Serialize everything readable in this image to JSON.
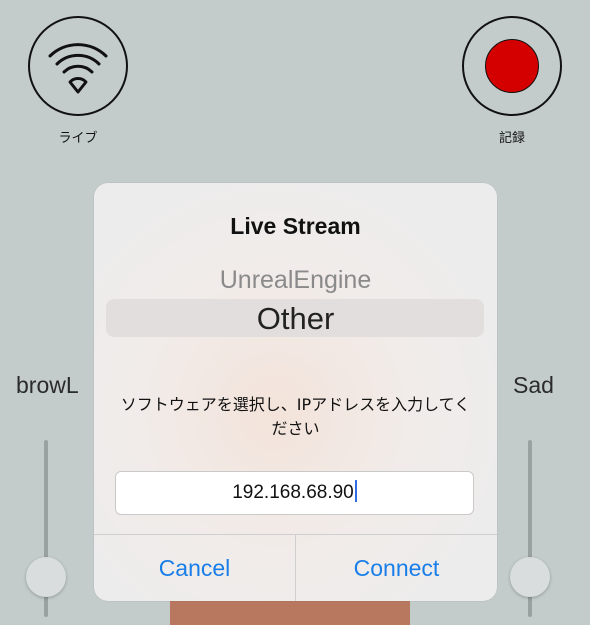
{
  "top_controls": {
    "live_label": "ライブ",
    "record_label": "記録",
    "record_color": "#d40000",
    "live_icon": "wifi-icon"
  },
  "sliders": {
    "left_label": "browL",
    "right_label": "Sad"
  },
  "dialog": {
    "title": "Live Stream",
    "picker_options": [
      "UnrealEngine",
      "Other"
    ],
    "picker_selected": "Other",
    "message": "ソフトウェアを選択し、IPアドレスを入力してください",
    "ip_value": "192.168.68.90",
    "cancel_label": "Cancel",
    "connect_label": "Connect",
    "accent_color": "#1a7ee8"
  }
}
